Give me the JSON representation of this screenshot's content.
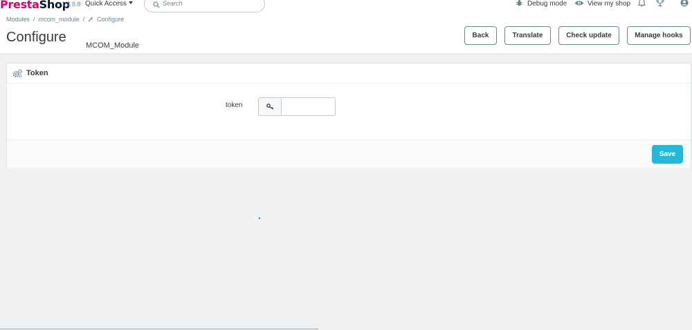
{
  "topbar": {
    "logo_prefix": "Presta",
    "logo_suffix": "Shop",
    "version": "1.7.8.8",
    "quick_access": "Quick Access",
    "search_placeholder": "Search",
    "debug_mode": "Debug mode",
    "view_shop": "View my shop"
  },
  "breadcrumb": [
    "Modules",
    "mcom_module",
    "Configure"
  ],
  "header": {
    "title": "Configure",
    "subtitle": "MCOM_Module",
    "buttons": {
      "back": "Back",
      "translate": "Translate",
      "check_update": "Check update",
      "manage_hooks": "Manage hooks"
    }
  },
  "panel": {
    "title": "Token",
    "field_label": "token",
    "token_value": "",
    "save": "Save"
  },
  "colors": {
    "accent": "#25b9d7",
    "text": "#363a41",
    "muted": "#6c868e",
    "background": "#eff1f2"
  }
}
